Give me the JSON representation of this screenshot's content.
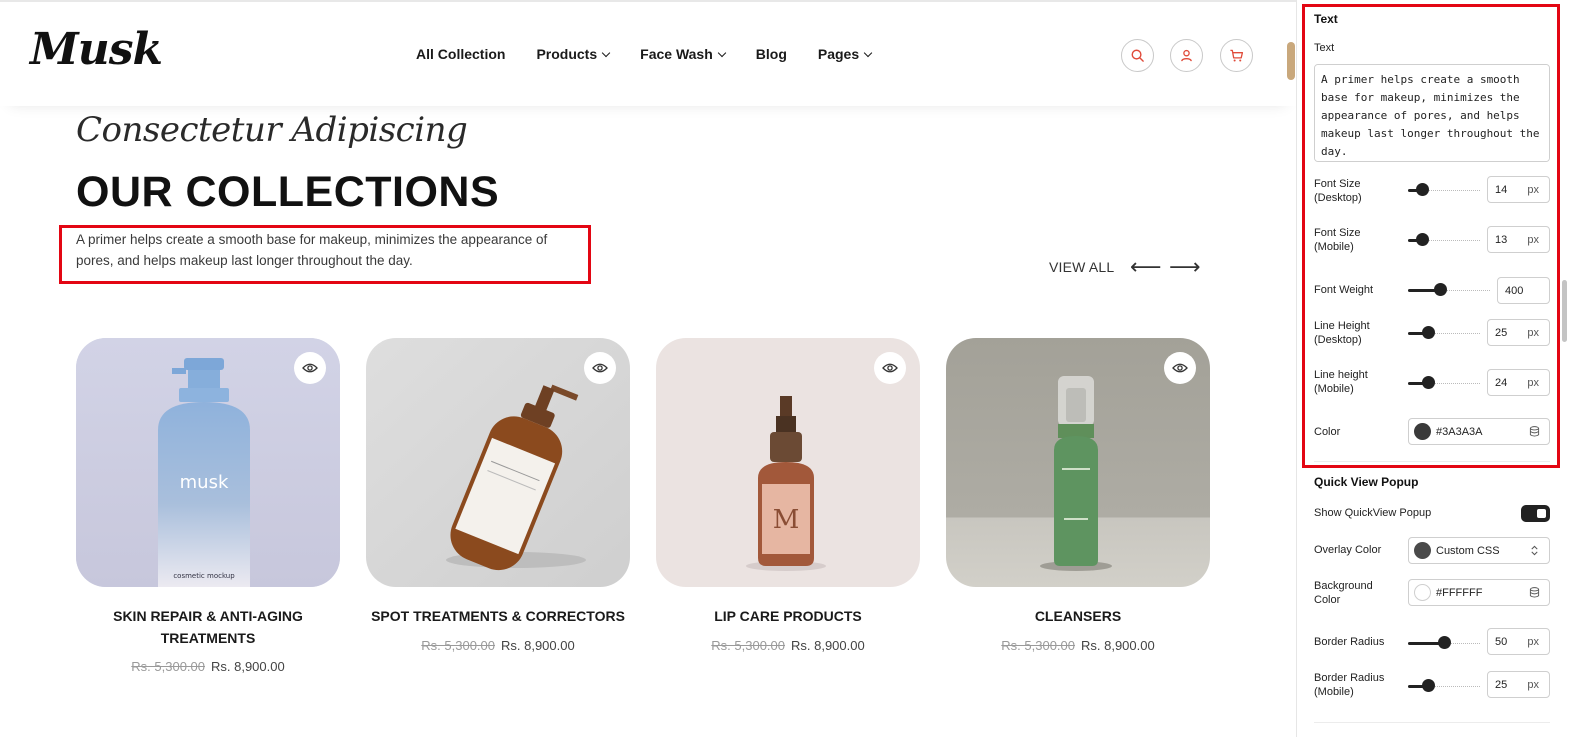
{
  "store": {
    "logo": "Musk",
    "nav": [
      {
        "label": "All Collection",
        "has_dropdown": false
      },
      {
        "label": "Products",
        "has_dropdown": true
      },
      {
        "label": "Face Wash",
        "has_dropdown": true
      },
      {
        "label": "Blog",
        "has_dropdown": false
      },
      {
        "label": "Pages",
        "has_dropdown": true
      }
    ],
    "icons": [
      "search-icon",
      "user-icon",
      "cart-icon"
    ],
    "accent_color": "#e04b3a"
  },
  "section": {
    "script_title": "Consectetur Adipiscing",
    "title": "OUR COLLECTIONS",
    "description": "A primer helps create a smooth base for makeup, minimizes the appearance of pores, and helps makeup last longer throughout the day.",
    "view_all": "VIEW ALL",
    "prev_arrow": "⟵",
    "next_arrow": "⟶"
  },
  "products": [
    {
      "title": "SKIN REPAIR & ANTI-AGING TREATMENTS",
      "old_price": "Rs. 5,300.00",
      "price": "Rs. 8,900.00",
      "bg": "#d4d6e6",
      "bottle_text": "musk",
      "bottle_sub": "cosmetic mockup"
    },
    {
      "title": "SPOT TREATMENTS & CORRECTORS",
      "old_price": "Rs. 5,300.00",
      "price": "Rs. 8,900.00",
      "bg": "#d9d9d9"
    },
    {
      "title": "LIP CARE PRODUCTS",
      "old_price": "Rs. 5,300.00",
      "price": "Rs. 8,900.00",
      "bg": "#ece4e2",
      "bottle_text": "M"
    },
    {
      "title": "CLEANSERS",
      "old_price": "Rs. 5,300.00",
      "price": "Rs. 8,900.00",
      "bg": "#a9a79f"
    }
  ],
  "panel": {
    "text_section": "Text",
    "text_label": "Text",
    "text_value": "A primer helps create a smooth base for makeup, minimizes the appearance of pores, and helps makeup last longer throughout the day.",
    "font_size_desktop": {
      "label_1": "Font Size",
      "label_2": "(Desktop)",
      "value": "14",
      "unit": "px"
    },
    "font_size_mobile": {
      "label_1": "Font Size",
      "label_2": "(Mobile)",
      "value": "13",
      "unit": "px"
    },
    "font_weight": {
      "label": "Font Weight",
      "value": "400"
    },
    "line_height_desktop": {
      "label_1": "Line Height",
      "label_2": "(Desktop)",
      "value": "25",
      "unit": "px"
    },
    "line_height_mobile": {
      "label_1": "Line height",
      "label_2": "(Mobile)",
      "value": "24",
      "unit": "px"
    },
    "color": {
      "label": "Color",
      "value": "#3A3A3A",
      "swatch": "#3a3a3a"
    },
    "quick_view_section": "Quick View Popup",
    "show_quickview": {
      "label": "Show QuickView Popup",
      "on": true
    },
    "overlay_color": {
      "label": "Overlay Color",
      "value": "Custom CSS",
      "swatch": "#4a4a4a"
    },
    "background_color": {
      "label_1": "Background",
      "label_2": "Color",
      "value": "#FFFFFF",
      "swatch": "#ffffff"
    },
    "border_radius": {
      "label": "Border Radius",
      "value": "50",
      "unit": "px"
    },
    "border_radius_mobile": {
      "label_1": "Border Radius",
      "label_2": "(Mobile)",
      "value": "25",
      "unit": "px"
    }
  }
}
